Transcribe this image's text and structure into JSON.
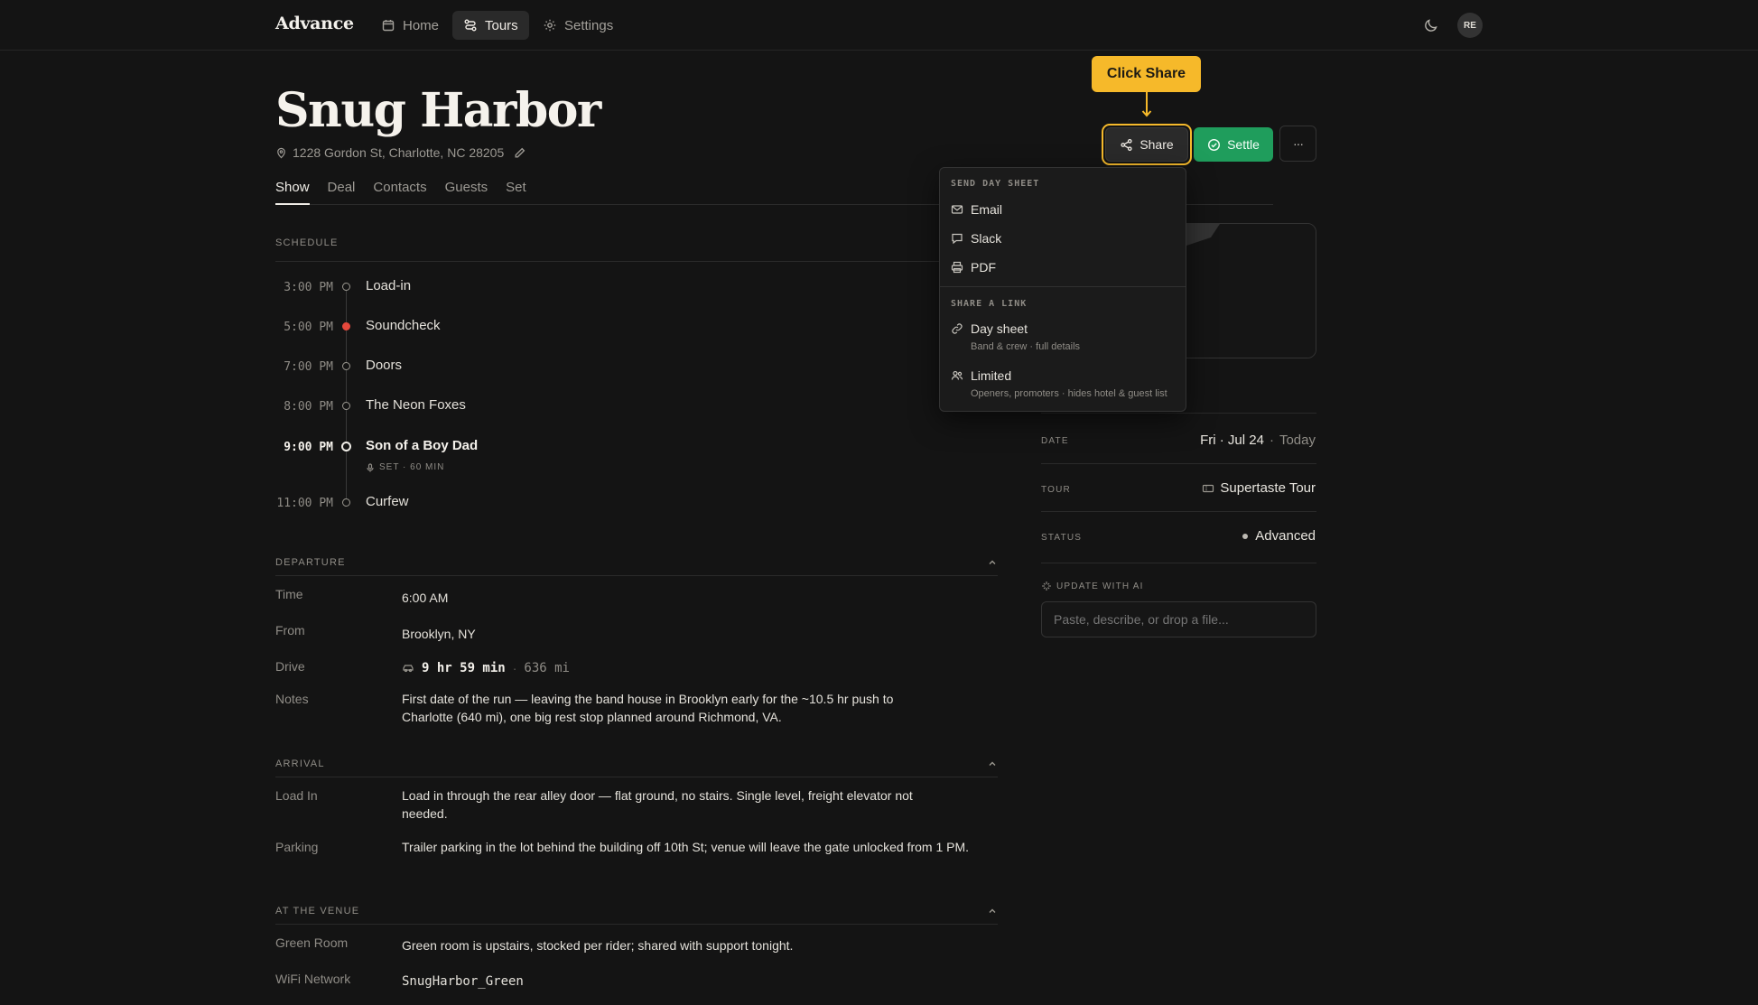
{
  "nav": {
    "brand": "Advance",
    "items": [
      {
        "label": "Home",
        "icon": "calendar-icon"
      },
      {
        "label": "Tours",
        "icon": "route-icon"
      },
      {
        "label": "Settings",
        "icon": "gear-icon"
      }
    ],
    "avatar": "RE"
  },
  "venue": {
    "title": "Snug Harbor",
    "address": "1228 Gordon St, Charlotte, NC 28205"
  },
  "tabs": [
    "Show",
    "Deal",
    "Contacts",
    "Guests",
    "Set"
  ],
  "schedule": {
    "label": "SCHEDULE",
    "items": [
      {
        "time": "3:00 PM",
        "name": "Load-in"
      },
      {
        "time": "5:00 PM",
        "name": "Soundcheck"
      },
      {
        "time": "7:00 PM",
        "name": "Doors"
      },
      {
        "time": "8:00 PM",
        "name": "The Neon Foxes"
      },
      {
        "time": "9:00 PM",
        "name": "Son of a Boy Dad",
        "sub": "SET · 60 MIN"
      },
      {
        "time": "11:00 PM",
        "name": "Curfew"
      }
    ]
  },
  "departure": {
    "label": "DEPARTURE",
    "time_key": "Time",
    "time_val": "6:00 AM",
    "from_key": "From",
    "from_val": "Brooklyn, NY",
    "drive_key": "Drive",
    "drive_time": "9 hr 59 min",
    "drive_sep": "·",
    "drive_dist": "636 mi",
    "notes_key": "Notes",
    "notes_val": "First date of the run — leaving the band house in Brooklyn early for the ~10.5 hr push to Charlotte (640 mi), one big rest stop planned around Richmond, VA."
  },
  "arrival": {
    "label": "ARRIVAL",
    "loadin_key": "Load In",
    "loadin_val": "Load in through the rear alley door — flat ground, no stairs. Single level, freight elevator not needed.",
    "parking_key": "Parking",
    "parking_val": "Trailer parking in the lot behind the building off 10th St; venue will leave the gate unlocked from 1 PM."
  },
  "venue_info": {
    "label": "AT THE VENUE",
    "green_key": "Green Room",
    "green_val": "Green room is upstairs, stocked per rider; shared with support tonight.",
    "wifi_key": "WiFi Network",
    "wifi_val": "SnugHarbor_Green"
  },
  "actions": {
    "share": "Share",
    "settle": "Settle",
    "more": "···",
    "callout": "Click Share"
  },
  "share_menu": {
    "send_head": "SEND DAY SHEET",
    "email": "Email",
    "slack": "Slack",
    "pdf": "PDF",
    "link_head": "SHARE A LINK",
    "day_sheet": "Day sheet",
    "day_sheet_sub": "Band & crew · full details",
    "limited": "Limited",
    "limited_sub": "Openers, promoters · hides hotel & guest list"
  },
  "details": {
    "date_label": "DATE",
    "date_val": "Fri · Jul 24",
    "date_sep": "·",
    "date_rel": "Today",
    "tour_label": "TOUR",
    "tour_val": "Supertaste Tour",
    "status_label": "STATUS",
    "status_val": "Advanced",
    "ai_label": "UPDATE WITH AI",
    "ai_placeholder": "Paste, describe, or drop a file..."
  },
  "colors": {
    "accent_share": "#f6b92a",
    "settle": "#1f9d5c",
    "soundcheck_dot": "#e5483c"
  }
}
